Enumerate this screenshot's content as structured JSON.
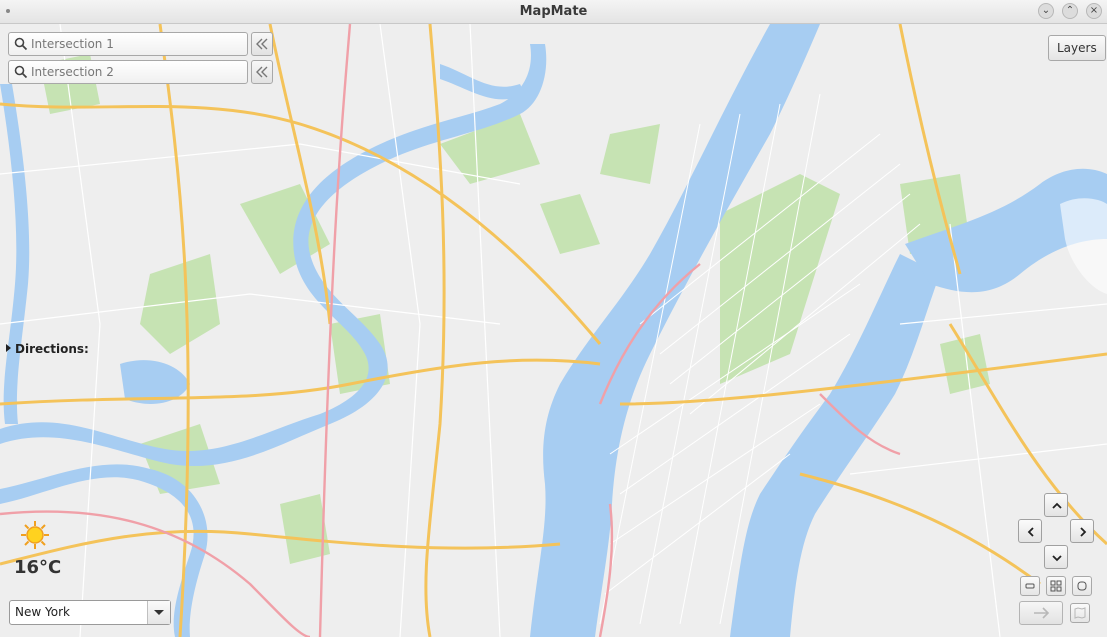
{
  "window": {
    "title": "MapMate",
    "controls": [
      "minimize-icon",
      "maximize-icon",
      "close-icon"
    ]
  },
  "search": {
    "intersection1": {
      "placeholder": "Intersection 1",
      "value": ""
    },
    "intersection2": {
      "placeholder": "Intersection 2",
      "value": ""
    }
  },
  "layers_label": "Layers",
  "directions_label": "Directions:",
  "weather": {
    "icon": "sun-icon",
    "temperature": "16°C"
  },
  "city_select": {
    "value": "New York"
  },
  "colors": {
    "land": "#eeeeee",
    "water": "#a7cdf2",
    "park": "#c6e3b3",
    "major_road": "#f4c35a",
    "highway": "#f0a0a8",
    "minor_road": "#ffffff"
  }
}
